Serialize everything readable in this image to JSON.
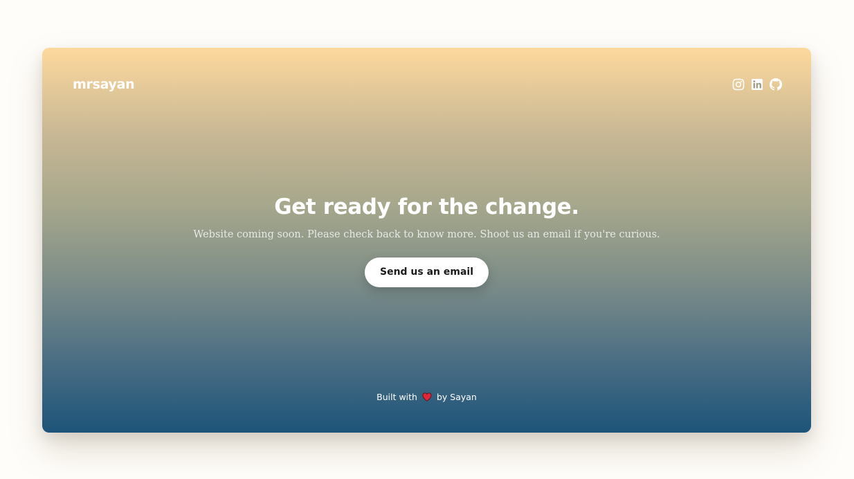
{
  "header": {
    "brand": "mrsayan",
    "socials": [
      {
        "name": "Instagram",
        "icon": "instagram-icon"
      },
      {
        "name": "LinkedIn",
        "icon": "linkedin-icon"
      },
      {
        "name": "GitHub",
        "icon": "github-icon"
      }
    ]
  },
  "hero": {
    "title": "Get ready for the change.",
    "subtitle": "Website coming soon. Please check back to know more. Shoot us an email if you're curious.",
    "cta_label": "Send us an email"
  },
  "footer": {
    "prefix": "Built with",
    "heart_icon": "heart-icon",
    "suffix": "by Sayan"
  },
  "colors": {
    "gradient_top": "#fdd99c",
    "gradient_bottom": "#1d5479",
    "heart": "#e0263a",
    "text": "#ffffff",
    "button_bg": "#ffffff",
    "button_text": "#1b1b1b"
  }
}
